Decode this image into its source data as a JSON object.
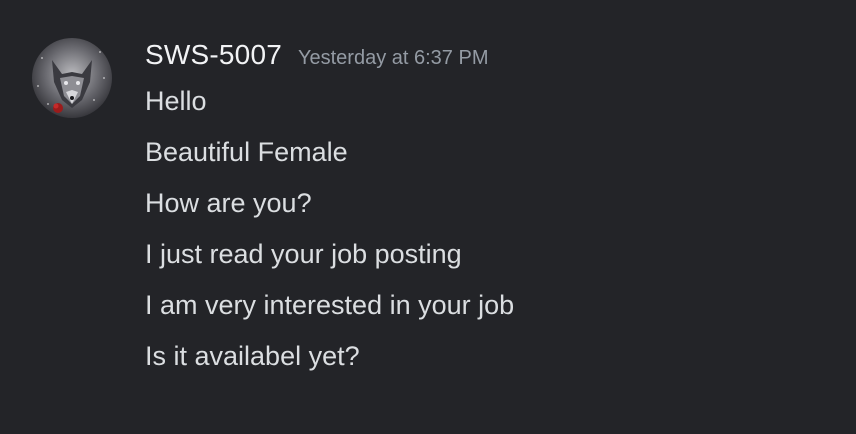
{
  "message": {
    "author": "SWS-5007",
    "timestamp": "Yesterday at 6:37 PM",
    "avatar_icon": "wolf-avatar-icon",
    "lines": [
      "Hello",
      "Beautiful Female",
      "How are you?",
      "I just read your job posting",
      "I am very interested in your job",
      "Is it availabel yet?"
    ]
  },
  "colors": {
    "background": "#232428",
    "username": "#f2f3f5",
    "timestamp": "#949ba4",
    "text": "#dbdee1"
  }
}
